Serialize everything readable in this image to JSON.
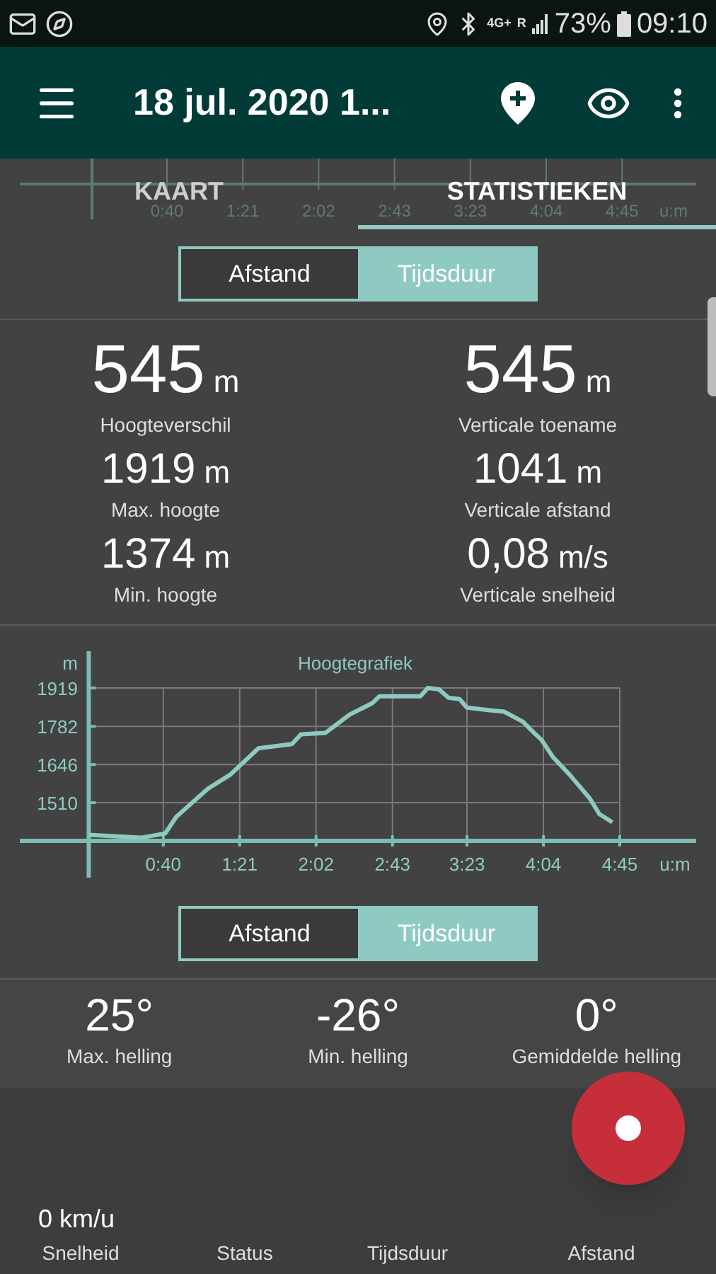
{
  "status_bar": {
    "network": "4G+",
    "roaming": "R",
    "battery": "73%",
    "time": "09:10"
  },
  "app_bar": {
    "title": "18 jul. 2020 1..."
  },
  "tabs": [
    {
      "label": "KAART",
      "selected": false
    },
    {
      "label": "STATISTIEKEN",
      "selected": true
    }
  ],
  "ghost_axis": {
    "labels": [
      "0:40",
      "1:21",
      "2:02",
      "2:43",
      "3:23",
      "4:04",
      "4:45"
    ],
    "unit": "u:m"
  },
  "toggle_top": [
    {
      "label": "Afstand",
      "selected": false
    },
    {
      "label": "Tijdsduur",
      "selected": true
    }
  ],
  "stats": [
    {
      "value": "545",
      "unit": "m",
      "label": "Hoogteverschil"
    },
    {
      "value": "545",
      "unit": "m",
      "label": "Verticale toename"
    },
    {
      "value": "1919",
      "unit": "m",
      "label": "Max. hoogte"
    },
    {
      "value": "1041",
      "unit": "m",
      "label": "Verticale afstand"
    },
    {
      "value": "1374",
      "unit": "m",
      "label": "Min. hoogte"
    },
    {
      "value": "0,08",
      "unit": "m/s",
      "label": "Verticale snelheid"
    }
  ],
  "elevation_chart": {
    "chart_data": {
      "type": "line",
      "title": "Hoogtegrafiek",
      "xlabel": "u:m",
      "ylabel": "m",
      "x": [
        0,
        28,
        41,
        47,
        64,
        76,
        91,
        109,
        114,
        127,
        140,
        152,
        156,
        178,
        182,
        188,
        193,
        199,
        203,
        216,
        223,
        233,
        239,
        243,
        249,
        258,
        269,
        274,
        281
      ],
      "series": [
        {
          "color": "#8ecac2",
          "values": [
            1395,
            1385,
            1400,
            1460,
            1560,
            1610,
            1704,
            1719,
            1754,
            1759,
            1824,
            1864,
            1889,
            1889,
            1919,
            1914,
            1884,
            1879,
            1849,
            1839,
            1834,
            1799,
            1759,
            1734,
            1674,
            1610,
            1525,
            1470,
            1440
          ]
        }
      ],
      "xlim": [
        -37,
        326
      ],
      "ylim": [
        1374,
        1919
      ],
      "grid": true,
      "xticks": [
        {
          "value": 40,
          "label": "0:40"
        },
        {
          "value": 81,
          "label": "1:21"
        },
        {
          "value": 122,
          "label": "2:02"
        },
        {
          "value": 163,
          "label": "2:43"
        },
        {
          "value": 203,
          "label": "3:23"
        },
        {
          "value": 244,
          "label": "4:04"
        },
        {
          "value": 285,
          "label": "4:45"
        }
      ],
      "yticks": [
        1510,
        1646,
        1782,
        1919
      ]
    }
  },
  "toggle_bottom": [
    {
      "label": "Afstand",
      "selected": false
    },
    {
      "label": "Tijdsduur",
      "selected": true
    }
  ],
  "slopes": [
    {
      "value": "25°",
      "label": "Max. helling"
    },
    {
      "value": "-26°",
      "label": "Min. helling"
    },
    {
      "value": "0°",
      "label": "Gemiddelde helling"
    }
  ],
  "footer": {
    "speed": "0 km/u",
    "labels": [
      "Snelheid",
      "Status",
      "Tijdsduur",
      "Afstand"
    ]
  }
}
